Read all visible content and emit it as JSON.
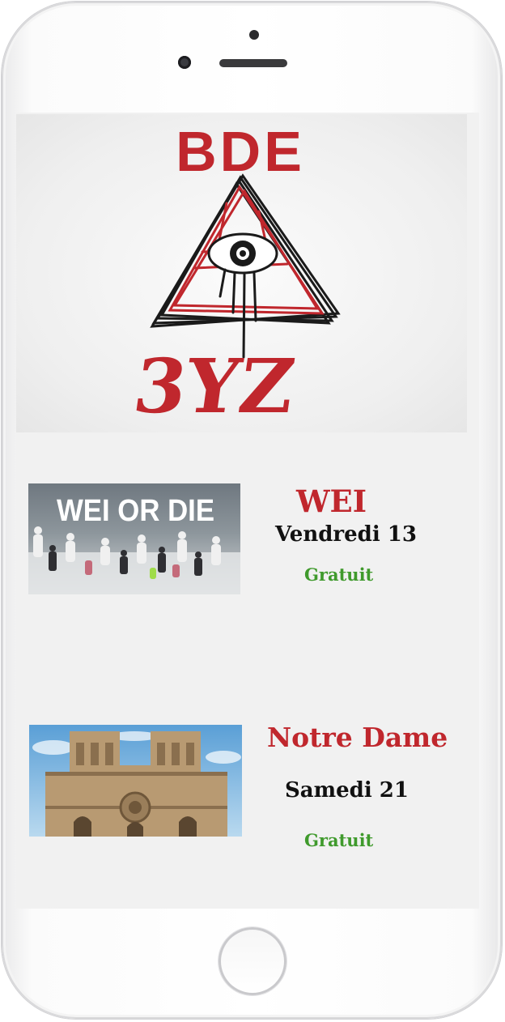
{
  "banner": {
    "logo_top": "BDE",
    "logo_bottom": "3YZ"
  },
  "events": [
    {
      "image_overlay": "WEI OR DIE",
      "title": "WEI",
      "date": "Vendredi 13",
      "price": "Gratuit"
    },
    {
      "title": "Notre Dame",
      "date": "Samedi 21",
      "price": "Gratuit"
    }
  ],
  "colors": {
    "brand_red": "#c0272d",
    "price_green": "#3f9a2c",
    "screen_bg": "#f1f1f1"
  }
}
